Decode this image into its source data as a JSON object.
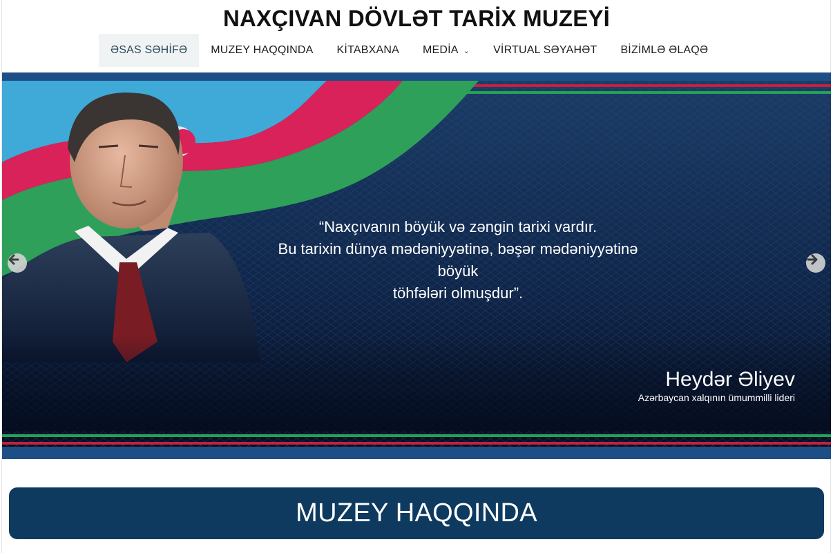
{
  "site": {
    "title": "NAXÇIVAN DÖVLƏT TARİX MUZEYİ"
  },
  "nav": {
    "items": [
      {
        "label": "ƏSAS SƏHİFƏ",
        "active": true
      },
      {
        "label": "MUZEY HAQQINDA"
      },
      {
        "label": "KİTABXANA"
      },
      {
        "label": "MEDİA",
        "has_dropdown": true
      },
      {
        "label": "VİRTUAL SƏYAHƏT"
      },
      {
        "label": "BİZİMLƏ ƏLAQƏ"
      }
    ]
  },
  "slider": {
    "quote_lines": [
      "“Naxçıvanın böyük və zəngin tarixi vardır.",
      "Bu tarixin dünya mədəniyyətinə, bəşər mədəniyyətinə böyük",
      "töhfələri olmuşdur”."
    ],
    "author_name": "Heydər Əliyev",
    "author_title": "Azərbaycan xalqının ümummilli lideri",
    "prev_icon": "arrow-left-icon",
    "next_icon": "arrow-right-icon"
  },
  "section": {
    "heading": "MUZEY HAQQINDA"
  },
  "colors": {
    "hero_background": "#0e2340",
    "section_band": "#0e3a5f",
    "flag_blue": "#3fa9d8",
    "flag_red": "#d9225a",
    "flag_green": "#2ea05a"
  }
}
